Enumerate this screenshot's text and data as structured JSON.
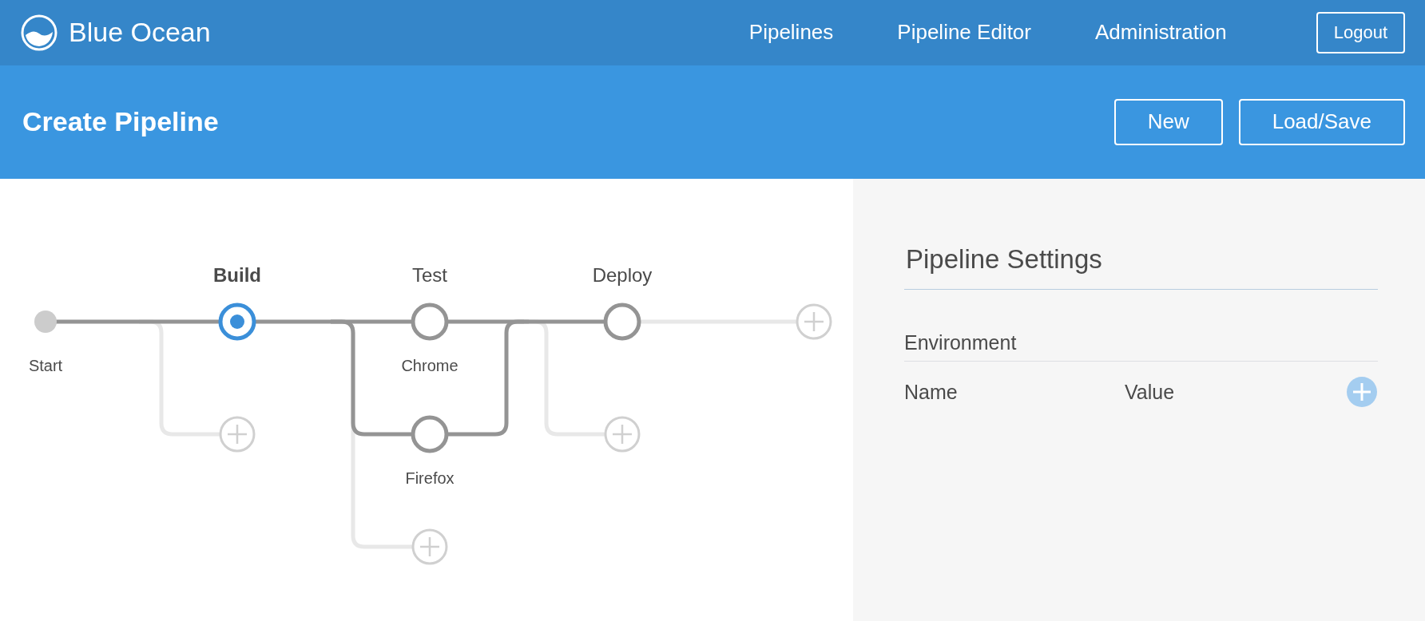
{
  "app": {
    "title": "Blue Ocean"
  },
  "nav": [
    "Pipelines",
    "Pipeline Editor",
    "Administration"
  ],
  "logout": "Logout",
  "header": {
    "title": "Create Pipeline",
    "buttons": [
      "New",
      "Load/Save"
    ]
  },
  "graph": {
    "start": "Start",
    "stages": [
      {
        "name": "Build",
        "selected": true
      },
      {
        "name": "Test",
        "selected": false,
        "branches": [
          "Chrome",
          "Firefox"
        ]
      },
      {
        "name": "Deploy",
        "selected": false
      }
    ]
  },
  "settings": {
    "title": "Pipeline Settings",
    "section": "Environment",
    "columns": [
      "Name",
      "Value"
    ]
  }
}
